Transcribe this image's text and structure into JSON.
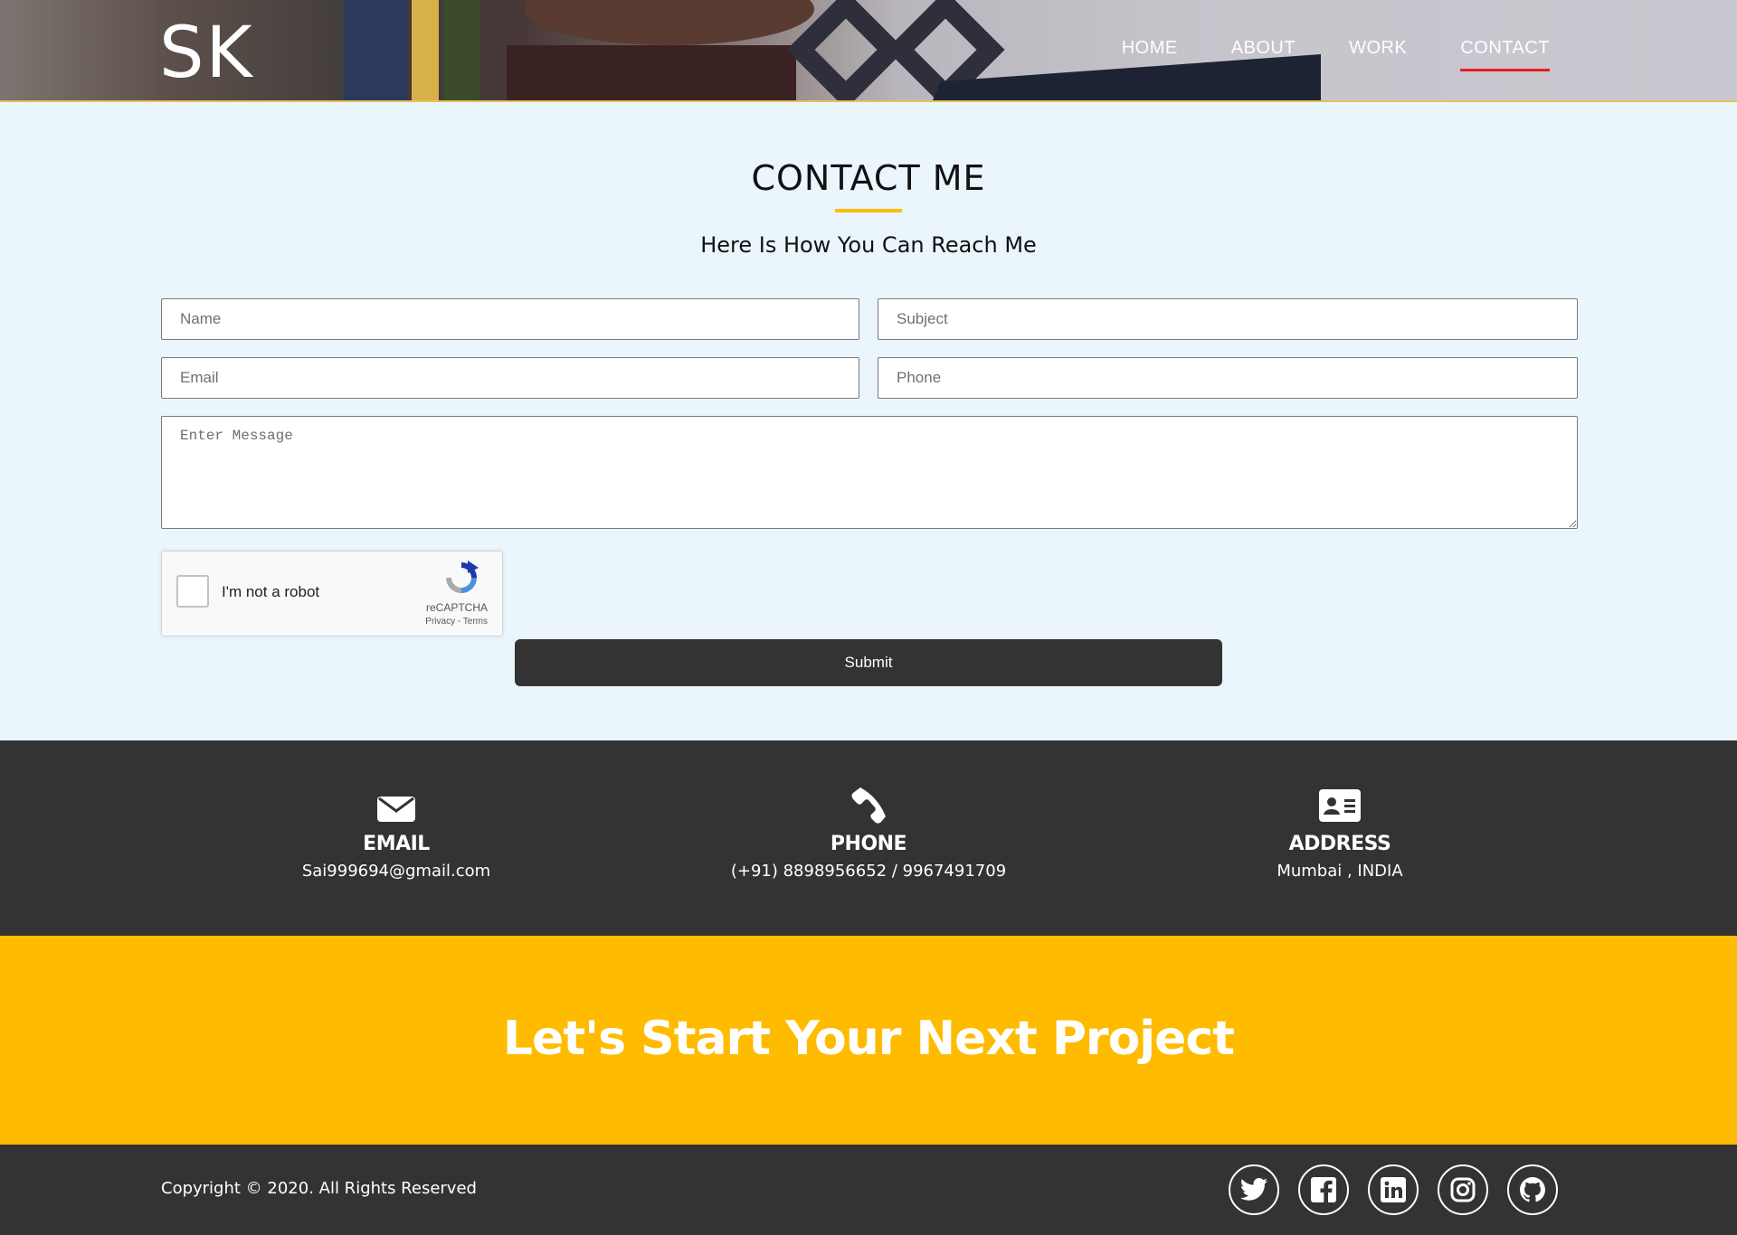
{
  "header": {
    "logo": "SK",
    "nav": [
      {
        "label": "HOME",
        "active": false
      },
      {
        "label": "ABOUT",
        "active": false
      },
      {
        "label": "WORK",
        "active": false
      },
      {
        "label": "CONTACT",
        "active": true
      }
    ]
  },
  "contact": {
    "title": "CONTACT ME",
    "subtitle": "Here Is How You Can Reach Me",
    "fields": {
      "name_placeholder": "Name",
      "subject_placeholder": "Subject",
      "email_placeholder": "Email",
      "phone_placeholder": "Phone",
      "message_placeholder": "Enter Message"
    },
    "captcha": {
      "label": "I'm not a robot",
      "brand": "reCAPTCHA",
      "terms": "Privacy - Terms"
    },
    "submit_label": "Submit"
  },
  "info": {
    "email": {
      "heading": "EMAIL",
      "value": "Sai999694@gmail.com",
      "icon": "envelope-icon"
    },
    "phone": {
      "heading": "PHONE",
      "value": "(+91) 8898956652 / 9967491709",
      "icon": "phone-icon"
    },
    "address": {
      "heading": "ADDRESS",
      "value": "Mumbai , INDIA",
      "icon": "address-card-icon"
    }
  },
  "cta": {
    "text": "Let's Start Your Next Project"
  },
  "footer": {
    "copyright": "Copyright © 2020. All Rights Reserved",
    "social": [
      "twitter-icon",
      "facebook-icon",
      "linkedin-icon",
      "instagram-icon",
      "github-icon"
    ]
  },
  "colors": {
    "accent_yellow": "#ffbb00",
    "dark": "#333333",
    "nav_active_underline": "#e81c1c",
    "page_bg": "#eaf5fc"
  }
}
